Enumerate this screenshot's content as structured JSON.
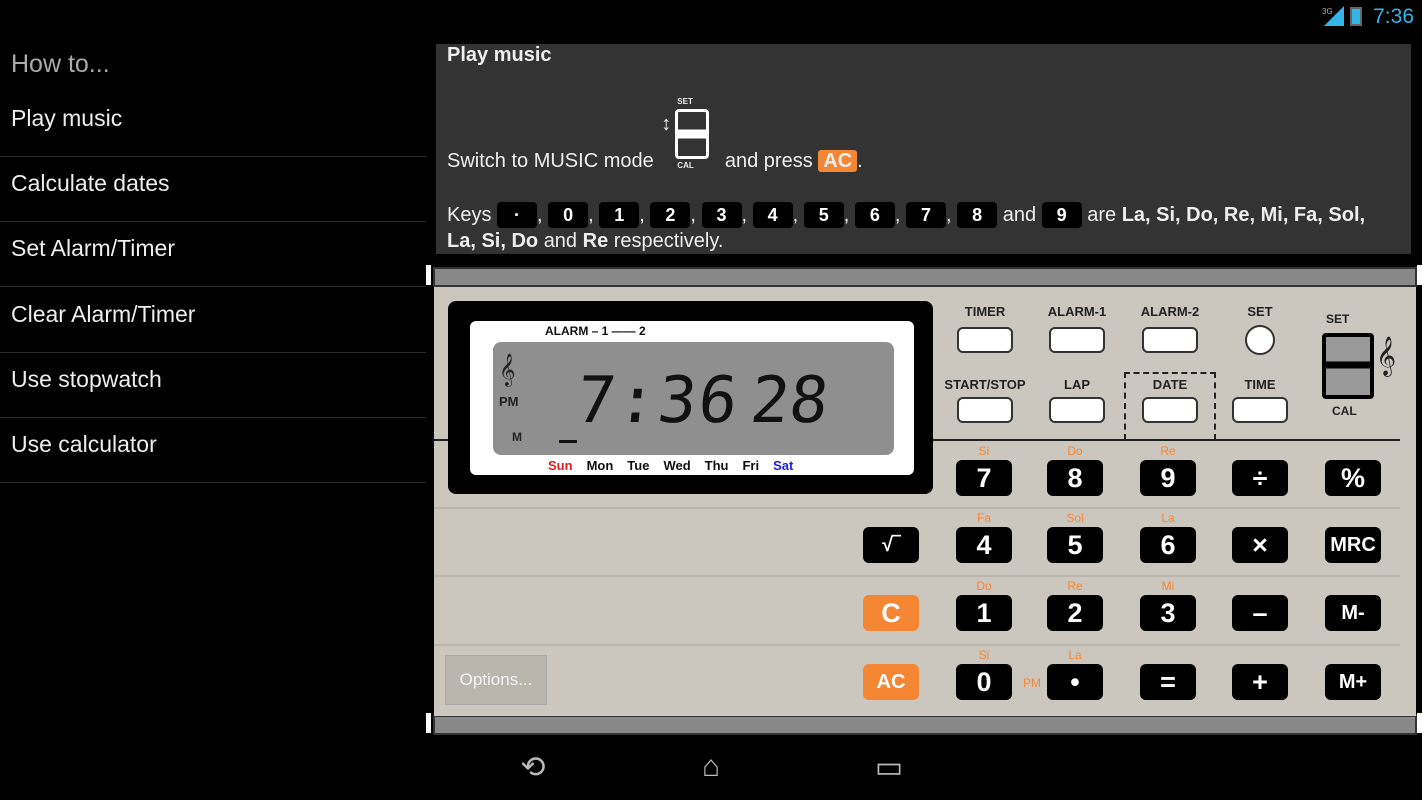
{
  "status": {
    "time": "7:36",
    "network": "3G",
    "icons": [
      "signal-icon",
      "battery-charging-icon"
    ]
  },
  "sidebar": {
    "heading": "How to...",
    "items": [
      {
        "label": "Play music"
      },
      {
        "label": "Calculate dates"
      },
      {
        "label": "Set Alarm/Timer"
      },
      {
        "label": "Clear Alarm/Timer"
      },
      {
        "label": "Use stopwatch"
      },
      {
        "label": "Use calculator"
      }
    ]
  },
  "help": {
    "title": "Play music",
    "line1_a": "Switch to MUSIC mode",
    "switch_set": "SET",
    "switch_cal": "CAL",
    "line1_b": "and press",
    "ac": "AC",
    "period": ".",
    "keys_label": "Keys",
    "keys": [
      "·",
      "0",
      "1",
      "2",
      "3",
      "4",
      "5",
      "6",
      "7",
      "8"
    ],
    "and": "and",
    "last_key": "9",
    "are": "are",
    "notes1": "La, Si, Do, Re, Mi, Fa, Sol,",
    "notes2": "La, Si, Do",
    "and2": "and",
    "notes3": "Re",
    "respectively": "respectively."
  },
  "display": {
    "alarm": "ALARM – 1 —— 2",
    "time": "7:36",
    "seconds": "28",
    "pm": "PM",
    "m": "M",
    "days": [
      "Sun",
      "Mon",
      "Tue",
      "Wed",
      "Thu",
      "Fri",
      "Sat"
    ]
  },
  "functions": {
    "row1": [
      "TIMER",
      "ALARM-1",
      "ALARM-2",
      "SET"
    ],
    "row2": [
      "START/STOP",
      "LAP",
      "DATE",
      "TIME"
    ]
  },
  "mode_switch": {
    "set": "SET",
    "cal": "CAL"
  },
  "keypad": {
    "rows": [
      [
        {
          "k": ""
        },
        {
          "k": "7",
          "n": "Si"
        },
        {
          "k": "8",
          "n": "Do"
        },
        {
          "k": "9",
          "n": "Re"
        },
        {
          "k": "÷"
        },
        {
          "k": "%"
        }
      ],
      [
        {
          "k": "√‾"
        },
        {
          "k": "4",
          "n": "Fa"
        },
        {
          "k": "5",
          "n": "Sol"
        },
        {
          "k": "6",
          "n": "La"
        },
        {
          "k": "×"
        },
        {
          "k": "MRC"
        }
      ],
      [
        {
          "k": "C",
          "o": true
        },
        {
          "k": "1",
          "n": "Do"
        },
        {
          "k": "2",
          "n": "Re"
        },
        {
          "k": "3",
          "n": "Mi"
        },
        {
          "k": "–"
        },
        {
          "k": "M-"
        }
      ],
      [
        {
          "k": "AC",
          "o": true
        },
        {
          "k": "0",
          "n": "Si"
        },
        {
          "k": "•",
          "n": "La"
        },
        {
          "k": "="
        },
        {
          "k": "+"
        },
        {
          "k": "M+"
        }
      ]
    ],
    "pm": "PM"
  },
  "options": "Options...",
  "colors": {
    "accent": "#f58634",
    "sun": "#e02020",
    "sat": "#2020e0",
    "status": "#33b5e5"
  }
}
